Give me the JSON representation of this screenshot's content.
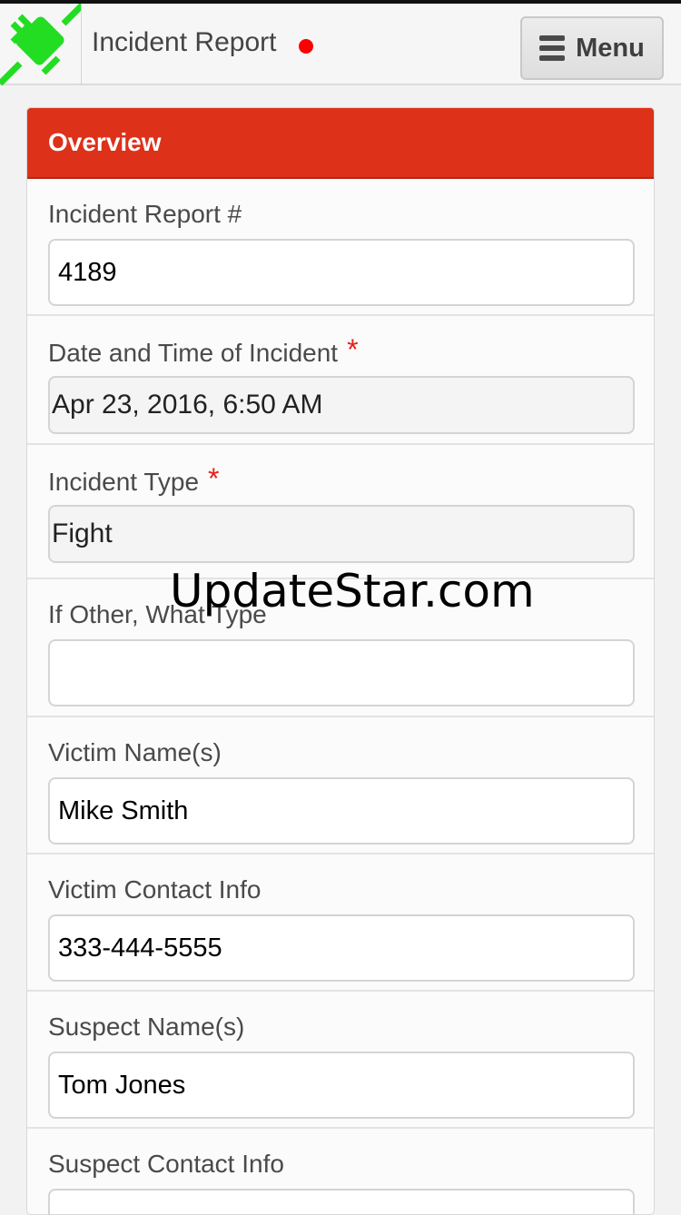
{
  "header": {
    "title": "Incident Report",
    "status_color": "#ff0000",
    "menu_label": "Menu",
    "logo_icon": "plug-icon",
    "logo_color": "#22dd22"
  },
  "card": {
    "title": "Overview",
    "accent_color": "#dd3119"
  },
  "fields": [
    {
      "label": "Incident Report #",
      "value": "4189",
      "required": false
    },
    {
      "label": "Date and Time of Incident",
      "value": "Apr 23, 2016, 6:50 AM",
      "required": true
    },
    {
      "label": "Incident Type",
      "value": "Fight",
      "required": true
    },
    {
      "label": "If Other, What Type",
      "value": "",
      "required": false
    },
    {
      "label": "Victim Name(s)",
      "value": "Mike Smith",
      "required": false
    },
    {
      "label": "Victim Contact Info",
      "value": "333-444-5555",
      "required": false
    },
    {
      "label": "Suspect Name(s)",
      "value": "Tom Jones",
      "required": false
    },
    {
      "label": "Suspect Contact Info",
      "value": "",
      "required": false
    }
  ],
  "required_marker": "*",
  "watermark": "UpdateStar.com"
}
